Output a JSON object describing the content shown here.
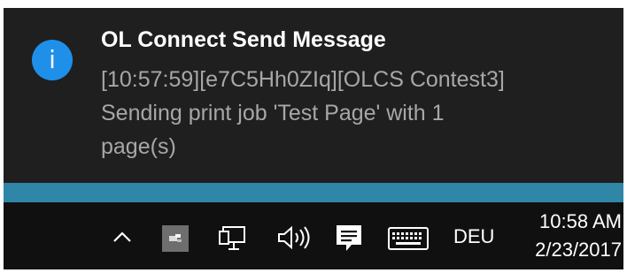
{
  "notification": {
    "icon": "info-icon",
    "title": "OL Connect Send Message",
    "lines": [
      "[10:57:59][e7C5Hh0ZIq][OLCS Contest3]",
      "Sending print job 'Test Page' with 1",
      "page(s)"
    ]
  },
  "taskbar": {
    "icons": [
      "chevron-up-icon",
      "app-tray-icon",
      "network-icon",
      "volume-icon",
      "action-center-icon",
      "touch-keyboard-icon"
    ],
    "language": "DEU",
    "time": "10:58 AM",
    "date": "2/23/2017"
  },
  "colors": {
    "toast_background": "#1f1f1f",
    "info_blue": "#1e90ea",
    "accent_strip": "#2f86a6",
    "taskbar_background": "#101010"
  }
}
